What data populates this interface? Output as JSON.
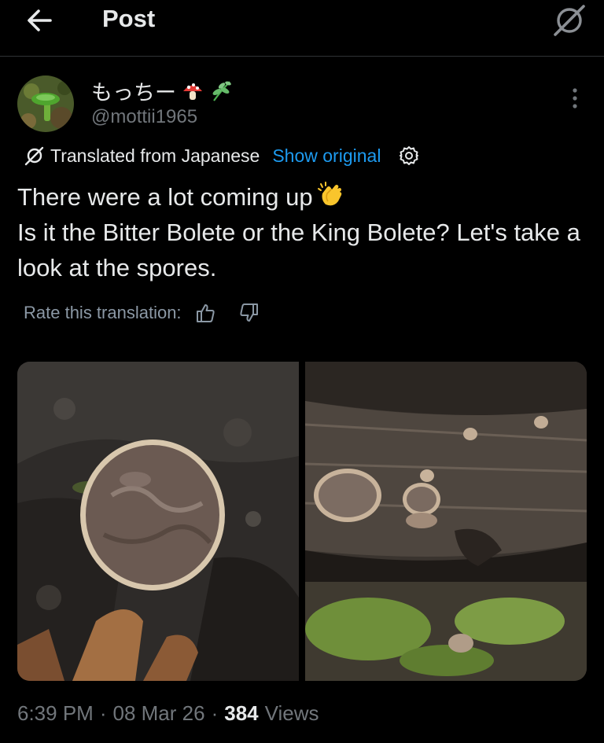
{
  "header": {
    "title": "Post",
    "back_icon": "arrow-left-icon",
    "grok_icon": "grok-icon"
  },
  "author": {
    "display_name": "もっちー",
    "name_emojis": [
      "mushroom-emoji",
      "herb-emoji"
    ],
    "handle": "@mottii1965"
  },
  "translation": {
    "label": "Translated from Japanese",
    "show_original": "Show original"
  },
  "post": {
    "lines": [
      "There were a lot coming up",
      "Is it the Bitter Bolete or the King Bolete? Let's take a look at the spores."
    ],
    "emoji": "clapping-hands-emoji"
  },
  "rating": {
    "label": "Rate this translation:"
  },
  "media": {
    "count": 2
  },
  "meta": {
    "time": "6:39 PM",
    "date": "08 Mar 26",
    "views_count": "384",
    "views_label": "Views",
    "separator": "·"
  },
  "colors": {
    "background": "#000000",
    "text": "#e7e9ea",
    "secondary": "#71767b",
    "link": "#1d9bf0"
  }
}
